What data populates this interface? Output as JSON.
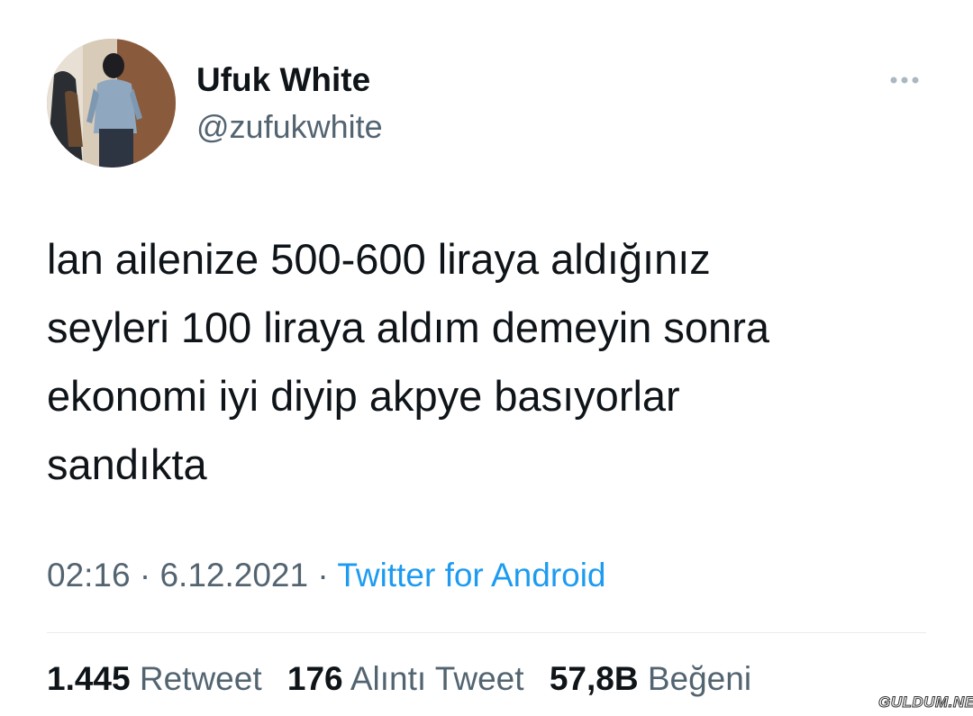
{
  "author": {
    "display_name": "Ufuk White",
    "handle": "@zufukwhite",
    "avatar_icon": "profile-photo"
  },
  "more_icon": "more-options-icon",
  "tweet": {
    "lines": [
      "lan ailenize 500-600 liraya aldığınız",
      "seyleri 100 liraya aldım demeyin sonra",
      "ekonomi iyi diyip akpye basıyorlar",
      "sandıkta"
    ]
  },
  "meta": {
    "time": "02:16",
    "separator": "·",
    "date": "6.12.2021",
    "source": "Twitter for Android"
  },
  "stats": {
    "retweets": {
      "count": "1.445",
      "label": "Retweet"
    },
    "quotes": {
      "count": "176",
      "label": "Alıntı Tweet"
    },
    "likes": {
      "count": "57,8B",
      "label": "Beğeni"
    }
  },
  "watermark": "GULDUM.NET",
  "colors": {
    "text": "#0f1419",
    "secondary": "#536471",
    "link": "#1d9bf0",
    "divider": "#e6ecf0"
  }
}
